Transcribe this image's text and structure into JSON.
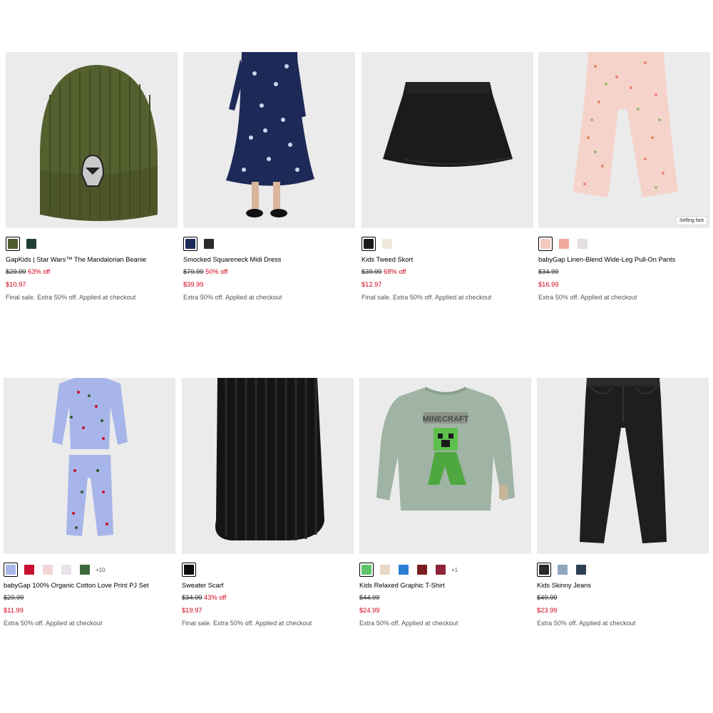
{
  "products": [
    {
      "name": "GapKids | Star Wars™ The Mandalorian Beanie",
      "original_price": "$29.99",
      "discount": "63% off",
      "sale_price": "$10.97",
      "promo": "Final sale. Extra 50% off. Applied at checkout",
      "badge": "",
      "swatch_colors": [
        "#4f5a2e",
        "#1f4036"
      ],
      "more": ""
    },
    {
      "name": "Smocked Squareneck Midi Dress",
      "original_price": "$79.99",
      "discount": "50% off",
      "sale_price": "$39.99",
      "promo": "Extra 50% off. Applied at checkout",
      "badge": "",
      "swatch_colors": [
        "#1e2a5a",
        "#2b2b2b"
      ],
      "more": ""
    },
    {
      "name": "Kids Tweed Skort",
      "original_price": "$39.99",
      "discount": "68% off",
      "sale_price": "$12.97",
      "promo": "Final sale. Extra 50% off. Applied at checkout",
      "badge": "",
      "swatch_colors": [
        "#1a1a1a",
        "#efe9dc"
      ],
      "more": ""
    },
    {
      "name": "babyGap Linen-Blend Wide-Leg Pull-On Pants",
      "original_price": "$34.99",
      "discount": "",
      "sale_price": "$16.99",
      "promo": "Extra 50% off. Applied at checkout",
      "badge": "Selling fast",
      "swatch_colors": [
        "#f3c8bd",
        "#f0a89a",
        "#e4dfe0"
      ],
      "more": ""
    },
    {
      "name": "babyGap 100% Organic Cotton Love Print PJ Set",
      "original_price": "$29.99",
      "discount": "",
      "sale_price": "$11.99",
      "promo": "Extra 50% off. Applied at checkout",
      "badge": "",
      "swatch_colors": [
        "#a9b6ea",
        "#c8102e",
        "#f2d6d6",
        "#e8e2ea",
        "#3b6b3a"
      ],
      "more": "+10"
    },
    {
      "name": "Sweater Scarf",
      "original_price": "$34.99",
      "discount": "43% off",
      "sale_price": "$19.97",
      "promo": "Final sale. Extra 50% off. Applied at checkout",
      "badge": "",
      "swatch_colors": [
        "#0d0d0d"
      ],
      "more": ""
    },
    {
      "name": "Kids Relaxed Graphic T-Shirt",
      "original_price": "$44.99",
      "discount": "",
      "sale_price": "$24.99",
      "promo": "Extra 50% off. Applied at checkout",
      "badge": "",
      "swatch_colors": [
        "#5ec46a",
        "#e9d7c6",
        "#2a7fd4",
        "#7a1f1f",
        "#8d2238"
      ],
      "more": "+1"
    },
    {
      "name": "Kids Skinny Jeans",
      "original_price": "$49.99",
      "discount": "",
      "sale_price": "$23.99",
      "promo": "Extra 50% off. Applied at checkout",
      "badge": "",
      "swatch_colors": [
        "#2a2a2a",
        "#8fa6bf",
        "#2e4052"
      ],
      "more": ""
    }
  ]
}
